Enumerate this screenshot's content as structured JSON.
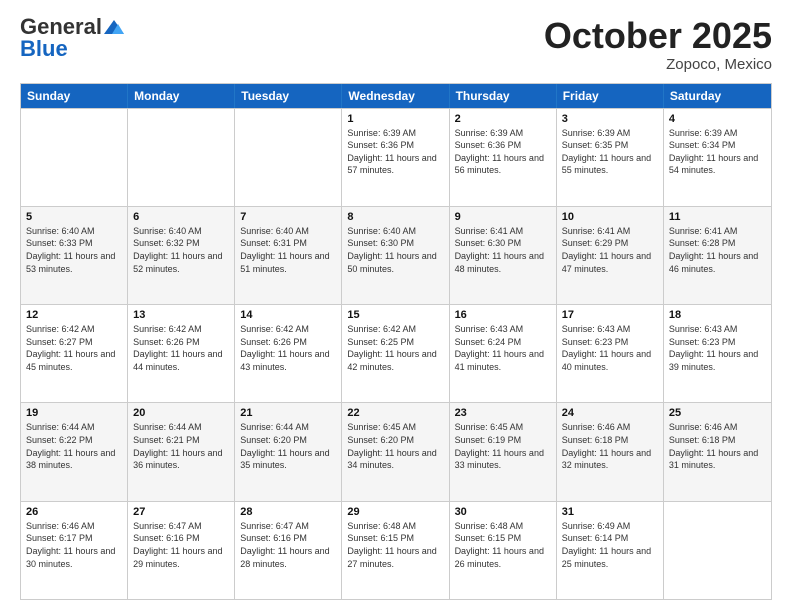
{
  "logo": {
    "general": "General",
    "blue": "Blue"
  },
  "title": "October 2025",
  "location": "Zopoco, Mexico",
  "header": {
    "days": [
      "Sunday",
      "Monday",
      "Tuesday",
      "Wednesday",
      "Thursday",
      "Friday",
      "Saturday"
    ]
  },
  "rows": [
    {
      "alt": false,
      "cells": [
        {
          "day": "",
          "sunrise": "",
          "sunset": "",
          "daylight": ""
        },
        {
          "day": "",
          "sunrise": "",
          "sunset": "",
          "daylight": ""
        },
        {
          "day": "",
          "sunrise": "",
          "sunset": "",
          "daylight": ""
        },
        {
          "day": "1",
          "sunrise": "Sunrise: 6:39 AM",
          "sunset": "Sunset: 6:36 PM",
          "daylight": "Daylight: 11 hours and 57 minutes."
        },
        {
          "day": "2",
          "sunrise": "Sunrise: 6:39 AM",
          "sunset": "Sunset: 6:36 PM",
          "daylight": "Daylight: 11 hours and 56 minutes."
        },
        {
          "day": "3",
          "sunrise": "Sunrise: 6:39 AM",
          "sunset": "Sunset: 6:35 PM",
          "daylight": "Daylight: 11 hours and 55 minutes."
        },
        {
          "day": "4",
          "sunrise": "Sunrise: 6:39 AM",
          "sunset": "Sunset: 6:34 PM",
          "daylight": "Daylight: 11 hours and 54 minutes."
        }
      ]
    },
    {
      "alt": true,
      "cells": [
        {
          "day": "5",
          "sunrise": "Sunrise: 6:40 AM",
          "sunset": "Sunset: 6:33 PM",
          "daylight": "Daylight: 11 hours and 53 minutes."
        },
        {
          "day": "6",
          "sunrise": "Sunrise: 6:40 AM",
          "sunset": "Sunset: 6:32 PM",
          "daylight": "Daylight: 11 hours and 52 minutes."
        },
        {
          "day": "7",
          "sunrise": "Sunrise: 6:40 AM",
          "sunset": "Sunset: 6:31 PM",
          "daylight": "Daylight: 11 hours and 51 minutes."
        },
        {
          "day": "8",
          "sunrise": "Sunrise: 6:40 AM",
          "sunset": "Sunset: 6:30 PM",
          "daylight": "Daylight: 11 hours and 50 minutes."
        },
        {
          "day": "9",
          "sunrise": "Sunrise: 6:41 AM",
          "sunset": "Sunset: 6:30 PM",
          "daylight": "Daylight: 11 hours and 48 minutes."
        },
        {
          "day": "10",
          "sunrise": "Sunrise: 6:41 AM",
          "sunset": "Sunset: 6:29 PM",
          "daylight": "Daylight: 11 hours and 47 minutes."
        },
        {
          "day": "11",
          "sunrise": "Sunrise: 6:41 AM",
          "sunset": "Sunset: 6:28 PM",
          "daylight": "Daylight: 11 hours and 46 minutes."
        }
      ]
    },
    {
      "alt": false,
      "cells": [
        {
          "day": "12",
          "sunrise": "Sunrise: 6:42 AM",
          "sunset": "Sunset: 6:27 PM",
          "daylight": "Daylight: 11 hours and 45 minutes."
        },
        {
          "day": "13",
          "sunrise": "Sunrise: 6:42 AM",
          "sunset": "Sunset: 6:26 PM",
          "daylight": "Daylight: 11 hours and 44 minutes."
        },
        {
          "day": "14",
          "sunrise": "Sunrise: 6:42 AM",
          "sunset": "Sunset: 6:26 PM",
          "daylight": "Daylight: 11 hours and 43 minutes."
        },
        {
          "day": "15",
          "sunrise": "Sunrise: 6:42 AM",
          "sunset": "Sunset: 6:25 PM",
          "daylight": "Daylight: 11 hours and 42 minutes."
        },
        {
          "day": "16",
          "sunrise": "Sunrise: 6:43 AM",
          "sunset": "Sunset: 6:24 PM",
          "daylight": "Daylight: 11 hours and 41 minutes."
        },
        {
          "day": "17",
          "sunrise": "Sunrise: 6:43 AM",
          "sunset": "Sunset: 6:23 PM",
          "daylight": "Daylight: 11 hours and 40 minutes."
        },
        {
          "day": "18",
          "sunrise": "Sunrise: 6:43 AM",
          "sunset": "Sunset: 6:23 PM",
          "daylight": "Daylight: 11 hours and 39 minutes."
        }
      ]
    },
    {
      "alt": true,
      "cells": [
        {
          "day": "19",
          "sunrise": "Sunrise: 6:44 AM",
          "sunset": "Sunset: 6:22 PM",
          "daylight": "Daylight: 11 hours and 38 minutes."
        },
        {
          "day": "20",
          "sunrise": "Sunrise: 6:44 AM",
          "sunset": "Sunset: 6:21 PM",
          "daylight": "Daylight: 11 hours and 36 minutes."
        },
        {
          "day": "21",
          "sunrise": "Sunrise: 6:44 AM",
          "sunset": "Sunset: 6:20 PM",
          "daylight": "Daylight: 11 hours and 35 minutes."
        },
        {
          "day": "22",
          "sunrise": "Sunrise: 6:45 AM",
          "sunset": "Sunset: 6:20 PM",
          "daylight": "Daylight: 11 hours and 34 minutes."
        },
        {
          "day": "23",
          "sunrise": "Sunrise: 6:45 AM",
          "sunset": "Sunset: 6:19 PM",
          "daylight": "Daylight: 11 hours and 33 minutes."
        },
        {
          "day": "24",
          "sunrise": "Sunrise: 6:46 AM",
          "sunset": "Sunset: 6:18 PM",
          "daylight": "Daylight: 11 hours and 32 minutes."
        },
        {
          "day": "25",
          "sunrise": "Sunrise: 6:46 AM",
          "sunset": "Sunset: 6:18 PM",
          "daylight": "Daylight: 11 hours and 31 minutes."
        }
      ]
    },
    {
      "alt": false,
      "cells": [
        {
          "day": "26",
          "sunrise": "Sunrise: 6:46 AM",
          "sunset": "Sunset: 6:17 PM",
          "daylight": "Daylight: 11 hours and 30 minutes."
        },
        {
          "day": "27",
          "sunrise": "Sunrise: 6:47 AM",
          "sunset": "Sunset: 6:16 PM",
          "daylight": "Daylight: 11 hours and 29 minutes."
        },
        {
          "day": "28",
          "sunrise": "Sunrise: 6:47 AM",
          "sunset": "Sunset: 6:16 PM",
          "daylight": "Daylight: 11 hours and 28 minutes."
        },
        {
          "day": "29",
          "sunrise": "Sunrise: 6:48 AM",
          "sunset": "Sunset: 6:15 PM",
          "daylight": "Daylight: 11 hours and 27 minutes."
        },
        {
          "day": "30",
          "sunrise": "Sunrise: 6:48 AM",
          "sunset": "Sunset: 6:15 PM",
          "daylight": "Daylight: 11 hours and 26 minutes."
        },
        {
          "day": "31",
          "sunrise": "Sunrise: 6:49 AM",
          "sunset": "Sunset: 6:14 PM",
          "daylight": "Daylight: 11 hours and 25 minutes."
        },
        {
          "day": "",
          "sunrise": "",
          "sunset": "",
          "daylight": ""
        }
      ]
    }
  ]
}
